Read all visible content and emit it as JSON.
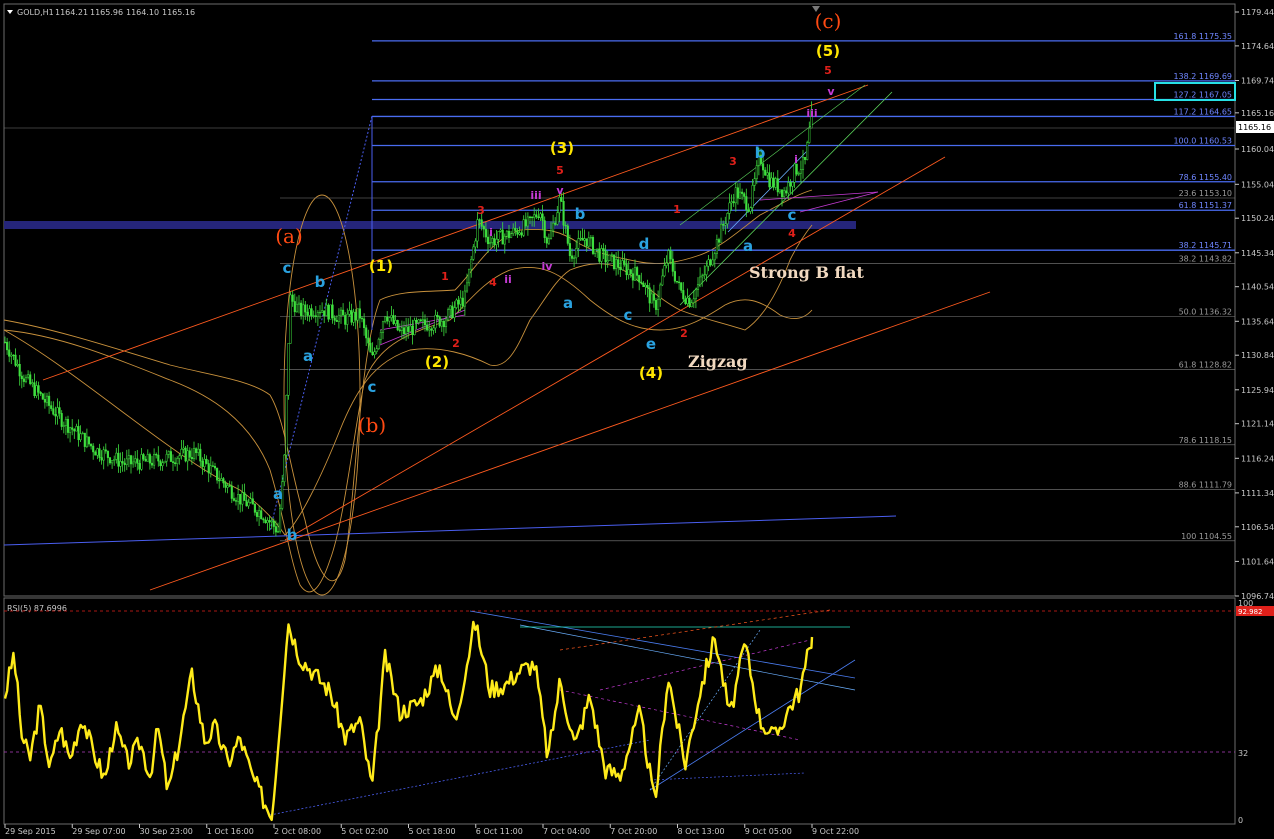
{
  "window": {
    "symbol_title": "GOLD,H1",
    "ohlc": [
      "1164.21",
      "1165.96",
      "1164.10",
      "1165.16"
    ]
  },
  "price_axis": {
    "ticks": [
      "1179.44",
      "1174.64",
      "1169.74",
      "1165.16",
      "1160.04",
      "1155.04",
      "1150.24",
      "1145.34",
      "1140.54",
      "1135.64",
      "1130.84",
      "1125.94",
      "1121.14",
      "1116.24",
      "1111.34",
      "1106.54",
      "1101.64",
      "1096.74"
    ],
    "current_price": "1165.16"
  },
  "time_axis": {
    "ticks": [
      "29 Sep 2015",
      "29 Sep 07:00",
      "30 Sep 23:00",
      "1 Oct 16:00",
      "2 Oct 08:00",
      "5 Oct 02:00",
      "5 Oct 18:00",
      "6 Oct 11:00",
      "7 Oct 04:00",
      "7 Oct 20:00",
      "8 Oct 13:00",
      "9 Oct 05:00",
      "9 Oct 22:00"
    ]
  },
  "fib_levels": [
    {
      "label": "161.8 1175.35",
      "color": "#4a6cf0"
    },
    {
      "label": "138.2 1169.69",
      "color": "#4a6cf0",
      "highlighted": true
    },
    {
      "label": "127.2 1167.05",
      "color": "#4a6cf0"
    },
    {
      "label": "117.2 1164.65",
      "color": "#4a6cf0"
    },
    {
      "label": "100.0 1160.53",
      "color": "#4a6cf0"
    },
    {
      "label": "78.6 1155.40",
      "color": "#4a6cf0"
    },
    {
      "label": "23.6 1153.10",
      "color": "#808080"
    },
    {
      "label": "61.8 1151.37",
      "color": "#4a6cf0"
    },
    {
      "label": "38.2 1145.71",
      "color": "#4a6cf0"
    },
    {
      "label": "38.2 1143.82",
      "color": "#808080"
    },
    {
      "label": "50.0 1136.32",
      "color": "#808080"
    },
    {
      "label": "61.8 1128.82",
      "color": "#808080"
    },
    {
      "label": "78.6 1118.15",
      "color": "#808080"
    },
    {
      "label": "88.6 1111.79",
      "color": "#808080"
    },
    {
      "label": "100 1104.55",
      "color": "#808080"
    }
  ],
  "wave_labels": [
    {
      "text": "(c)",
      "color": "#ff4a12",
      "size": "big"
    },
    {
      "text": "(5)",
      "color": "#ffe600",
      "size": "mid"
    },
    {
      "text": "5",
      "color": "#e0201a",
      "size": "sm"
    },
    {
      "text": "v",
      "color": "#c63bd6",
      "size": "sm"
    },
    {
      "text": "iii",
      "color": "#c63bd6",
      "size": "sm"
    },
    {
      "text": "(3)",
      "color": "#ffe600",
      "size": "mid"
    },
    {
      "text": "5",
      "color": "#e0201a",
      "size": "sm"
    },
    {
      "text": "iii",
      "color": "#c63bd6",
      "size": "sm"
    },
    {
      "text": "v",
      "color": "#c63bd6",
      "size": "sm"
    },
    {
      "text": "3",
      "color": "#e0201a",
      "size": "sm"
    },
    {
      "text": "i",
      "color": "#c63bd6",
      "size": "sm"
    },
    {
      "text": "b",
      "color": "#2aa2e0",
      "size": "mid"
    },
    {
      "text": "1",
      "color": "#e0201a",
      "size": "sm"
    },
    {
      "text": "3",
      "color": "#e0201a",
      "size": "sm"
    },
    {
      "text": "b",
      "color": "#2aa2e0",
      "size": "mid"
    },
    {
      "text": "i",
      "color": "#c63bd6",
      "size": "sm"
    },
    {
      "text": "(a)",
      "color": "#ff4a12",
      "size": "big"
    },
    {
      "text": "c",
      "color": "#2aa2e0",
      "size": "mid"
    },
    {
      "text": "b",
      "color": "#2aa2e0",
      "size": "mid"
    },
    {
      "text": "(1)",
      "color": "#ffe600",
      "size": "mid"
    },
    {
      "text": "1",
      "color": "#e0201a",
      "size": "sm"
    },
    {
      "text": "4",
      "color": "#e0201a",
      "size": "sm"
    },
    {
      "text": "ii",
      "color": "#c63bd6",
      "size": "sm"
    },
    {
      "text": "iv",
      "color": "#c63bd6",
      "size": "sm"
    },
    {
      "text": "d",
      "color": "#2aa2e0",
      "size": "mid"
    },
    {
      "text": "c",
      "color": "#2aa2e0",
      "size": "mid"
    },
    {
      "text": "a",
      "color": "#2aa2e0",
      "size": "mid"
    },
    {
      "text": "4",
      "color": "#e0201a",
      "size": "sm"
    },
    {
      "text": "a",
      "color": "#2aa2e0",
      "size": "mid"
    },
    {
      "text": "a",
      "color": "#2aa2e0",
      "size": "mid"
    },
    {
      "text": "2",
      "color": "#e0201a",
      "size": "sm"
    },
    {
      "text": "(2)",
      "color": "#ffe600",
      "size": "mid"
    },
    {
      "text": "c",
      "color": "#2aa2e0",
      "size": "mid"
    },
    {
      "text": "c",
      "color": "#2aa2e0",
      "size": "mid"
    },
    {
      "text": "2",
      "color": "#e0201a",
      "size": "sm"
    },
    {
      "text": "e",
      "color": "#2aa2e0",
      "size": "mid"
    },
    {
      "text": "(4)",
      "color": "#ffe600",
      "size": "mid"
    },
    {
      "text": "(b)",
      "color": "#ff4a12",
      "size": "big"
    },
    {
      "text": "a",
      "color": "#2aa2e0",
      "size": "mid"
    },
    {
      "text": "b",
      "color": "#2aa2e0",
      "size": "mid"
    }
  ],
  "annotations": [
    "Strong B flat",
    "Zigzag"
  ],
  "rsi": {
    "title": "RSI(5) 87.6996",
    "axis_ticks": [
      "100",
      "32",
      "0"
    ],
    "marker": "92.982"
  },
  "chart_data": {
    "type": "candlestick",
    "symbol": "GOLD",
    "timeframe": "H1",
    "last_ohlc": {
      "open": 1164.21,
      "high": 1165.96,
      "low": 1164.1,
      "close": 1165.16
    },
    "x_range": [
      "29 Sep 2015",
      "9 Oct 22:00"
    ],
    "ylim": [
      1096.74,
      1179.44
    ],
    "price_path": [
      {
        "t": 0,
        "price": 1134.0
      },
      {
        "t": 25,
        "price": 1127.5
      },
      {
        "t": 60,
        "price": 1122.0
      },
      {
        "t": 95,
        "price": 1117.5
      },
      {
        "t": 125,
        "price": 1115.5
      },
      {
        "t": 150,
        "price": 1115.8
      },
      {
        "t": 175,
        "price": 1116.5
      },
      {
        "t": 195,
        "price": 1117.0
      },
      {
        "t": 215,
        "price": 1114.0
      },
      {
        "t": 240,
        "price": 1110.5
      },
      {
        "t": 262,
        "price": 1108.5
      },
      {
        "t": 278,
        "price": 1106.0
      },
      {
        "t": 284,
        "price": 1115.0
      },
      {
        "t": 290,
        "price": 1139.0
      },
      {
        "t": 300,
        "price": 1137.0
      },
      {
        "t": 320,
        "price": 1137.5
      },
      {
        "t": 345,
        "price": 1136.0
      },
      {
        "t": 360,
        "price": 1136.5
      },
      {
        "t": 372,
        "price": 1130.0
      },
      {
        "t": 385,
        "price": 1137.0
      },
      {
        "t": 400,
        "price": 1134.0
      },
      {
        "t": 420,
        "price": 1135.0
      },
      {
        "t": 445,
        "price": 1136.0
      },
      {
        "t": 465,
        "price": 1139.0
      },
      {
        "t": 478,
        "price": 1150.0
      },
      {
        "t": 490,
        "price": 1147.0
      },
      {
        "t": 510,
        "price": 1148.0
      },
      {
        "t": 530,
        "price": 1149.5
      },
      {
        "t": 540,
        "price": 1151.5
      },
      {
        "t": 548,
        "price": 1146.5
      },
      {
        "t": 560,
        "price": 1153.0
      },
      {
        "t": 570,
        "price": 1145.0
      },
      {
        "t": 585,
        "price": 1147.5
      },
      {
        "t": 600,
        "price": 1145.0
      },
      {
        "t": 620,
        "price": 1143.5
      },
      {
        "t": 640,
        "price": 1142.0
      },
      {
        "t": 655,
        "price": 1137.5
      },
      {
        "t": 668,
        "price": 1145.0
      },
      {
        "t": 680,
        "price": 1140.0
      },
      {
        "t": 690,
        "price": 1138.5
      },
      {
        "t": 705,
        "price": 1142.5
      },
      {
        "t": 720,
        "price": 1148.0
      },
      {
        "t": 735,
        "price": 1154.0
      },
      {
        "t": 750,
        "price": 1152.0
      },
      {
        "t": 760,
        "price": 1159.0
      },
      {
        "t": 770,
        "price": 1155.5
      },
      {
        "t": 785,
        "price": 1154.0
      },
      {
        "t": 795,
        "price": 1157.0
      },
      {
        "t": 805,
        "price": 1158.0
      },
      {
        "t": 812,
        "price": 1165.16
      }
    ],
    "rsi_period": 5,
    "rsi_last": 87.6996,
    "rsi_ylim": [
      0,
      100
    ],
    "rsi_levels": [
      32
    ],
    "rsi_path": [
      {
        "t": 5,
        "v": 60
      },
      {
        "t": 14,
        "v": 80
      },
      {
        "t": 22,
        "v": 40
      },
      {
        "t": 30,
        "v": 30
      },
      {
        "t": 40,
        "v": 55
      },
      {
        "t": 50,
        "v": 25
      },
      {
        "t": 60,
        "v": 45
      },
      {
        "t": 70,
        "v": 30
      },
      {
        "t": 82,
        "v": 50
      },
      {
        "t": 92,
        "v": 35
      },
      {
        "t": 105,
        "v": 20
      },
      {
        "t": 115,
        "v": 45
      },
      {
        "t": 128,
        "v": 28
      },
      {
        "t": 140,
        "v": 38
      },
      {
        "t": 150,
        "v": 22
      },
      {
        "t": 158,
        "v": 45
      },
      {
        "t": 168,
        "v": 14
      },
      {
        "t": 178,
        "v": 35
      },
      {
        "t": 192,
        "v": 70
      },
      {
        "t": 205,
        "v": 38
      },
      {
        "t": 215,
        "v": 45
      },
      {
        "t": 228,
        "v": 28
      },
      {
        "t": 240,
        "v": 40
      },
      {
        "t": 252,
        "v": 22
      },
      {
        "t": 262,
        "v": 12
      },
      {
        "t": 272,
        "v": 2
      },
      {
        "t": 288,
        "v": 95
      },
      {
        "t": 300,
        "v": 78
      },
      {
        "t": 315,
        "v": 70
      },
      {
        "t": 330,
        "v": 62
      },
      {
        "t": 345,
        "v": 40
      },
      {
        "t": 360,
        "v": 48
      },
      {
        "t": 372,
        "v": 16
      },
      {
        "t": 385,
        "v": 78
      },
      {
        "t": 400,
        "v": 52
      },
      {
        "t": 420,
        "v": 57
      },
      {
        "t": 440,
        "v": 74
      },
      {
        "t": 455,
        "v": 47
      },
      {
        "t": 475,
        "v": 95
      },
      {
        "t": 490,
        "v": 63
      },
      {
        "t": 505,
        "v": 65
      },
      {
        "t": 520,
        "v": 72
      },
      {
        "t": 535,
        "v": 75
      },
      {
        "t": 548,
        "v": 30
      },
      {
        "t": 560,
        "v": 67
      },
      {
        "t": 575,
        "v": 36
      },
      {
        "t": 590,
        "v": 60
      },
      {
        "t": 605,
        "v": 25
      },
      {
        "t": 620,
        "v": 22
      },
      {
        "t": 640,
        "v": 52
      },
      {
        "t": 655,
        "v": 8
      },
      {
        "t": 668,
        "v": 70
      },
      {
        "t": 685,
        "v": 27
      },
      {
        "t": 700,
        "v": 62
      },
      {
        "t": 715,
        "v": 88
      },
      {
        "t": 730,
        "v": 50
      },
      {
        "t": 745,
        "v": 85
      },
      {
        "t": 760,
        "v": 48
      },
      {
        "t": 775,
        "v": 40
      },
      {
        "t": 790,
        "v": 55
      },
      {
        "t": 800,
        "v": 62
      },
      {
        "t": 812,
        "v": 87.7
      }
    ]
  }
}
